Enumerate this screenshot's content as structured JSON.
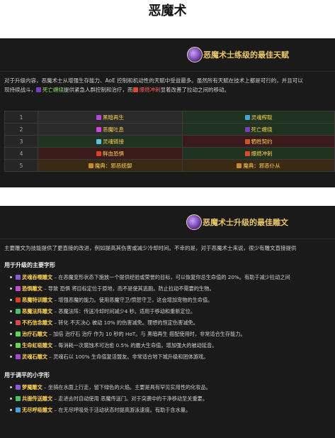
{
  "page": {
    "title": "恶魔术"
  },
  "talents_section": {
    "title": "恶魔术士练级的最佳天赋",
    "intro_line1": "对于升级内容，恶魔术士从增强生存能力、AoE 控制和机动性的天赋中受益最多。虽然所有天赋在技术上都是可行的，并且可以",
    "intro_line2_pre": "现持续战斗，",
    "intro_line2_link1": "死亡缠绕",
    "intro_line2_mid": "提供紧急人群控制和治疗，而",
    "intro_line2_link2": "爆燃冲刺",
    "intro_line2_post": "显着改善了拉动之间的移动。",
    "rows": [
      {
        "level": "1",
        "left": "黑暗再生",
        "right": "灵魂榨取",
        "left_bg": "gray",
        "right_bg": "green"
      },
      {
        "level": "2",
        "left": "恶魔吐息",
        "right": "死亡缠绕",
        "left_bg": "gray",
        "right_bg": "green"
      },
      {
        "level": "3",
        "left": "灵魂链接",
        "right": "牺牲契约",
        "left_bg": "green",
        "right_bg": "red"
      },
      {
        "level": "4",
        "left": "鲜血恐惧",
        "right": "爆燃冲刺",
        "left_bg": "red",
        "right_bg": "green"
      },
      {
        "level": "5",
        "left": "魔典：邪恶统御",
        "right": "魔典：邪恶仆从",
        "left_bg": "brown",
        "right_bg": "brown"
      }
    ]
  },
  "glyphs_section": {
    "title": "恶魔术士升级的最佳雕文",
    "intro": "主要雕文为技能提供了更直接的改进，例如提高其伤害或减少冷却时间。不幸的是，对于恶魔术士来说，很少有雕文直接提供",
    "major_heading": "用于升级的主要字形",
    "major": [
      {
        "name": "灵魂吞噬雕文",
        "text": " – 在恶魔变形状态下施放一个提供经验或荣誉的目标，可以恢复你总生命值的 20%。有助于减少拉动之间"
      },
      {
        "name": "恐惧雕文",
        "text": " – 导致 恐惧 将目标定位于原地，而不是使其逃跑。防止拉动不需要的生物。"
      },
      {
        "name": "恶魔特训雕文",
        "text": " – 增强恶魔的能力。使用恶魔守卫/愤怒守卫，这会增加宠物的生命值。"
      },
      {
        "name": "恶魔法阵雕文",
        "text": " – 恶魔法阵：传送冷却时间减少4 秒。适用于移动和重新定位。"
      },
      {
        "name": "不朽信念雕文",
        "text": " – 转化 不灭决心 被动 10% 的伤害减免。理想的恒定伤害减免。"
      },
      {
        "name": "治疗石雕文",
        "text": " – 加倍 治疗石 治疗 作为 10 秒的 HoT。与 黑暗再生 搭配使用时，非常适合生存能力。"
      },
      {
        "name": "生命虹吸雕文",
        "text": " – 每消耗一次腐蚀术可治愈 0.5% 的最大生命值。增加强大的被动延音。"
      },
      {
        "name": "灵魂石雕文",
        "text": " – 灵魂石以 100% 生命值复活盟友。非常适合地下城升级和团体游戏。"
      }
    ],
    "minor_heading": "用于调平的小字形",
    "minor": [
      {
        "name": "梦魇雕文",
        "text": " – 坐骑在水面上行走，留下绿色的火焰。主要是具有罕见实用性的化妆品。"
      },
      {
        "name": "共振传送雕文",
        "text": " – 走进去时自动使用 恶魔传送门。对于突袭中的干净移动至关重要。"
      },
      {
        "name": "无尽呼吸雕文",
        "text": " – 在无尽呼吸处于活动状态时提高游泳速度。有助于含水量。"
      }
    ]
  },
  "colors": {
    "panel_bg": "#1a1a1a",
    "gold": "#e8c56a",
    "green": "#8fe06a",
    "red": "#ff5b5b",
    "yellow": "#ffd24d"
  }
}
